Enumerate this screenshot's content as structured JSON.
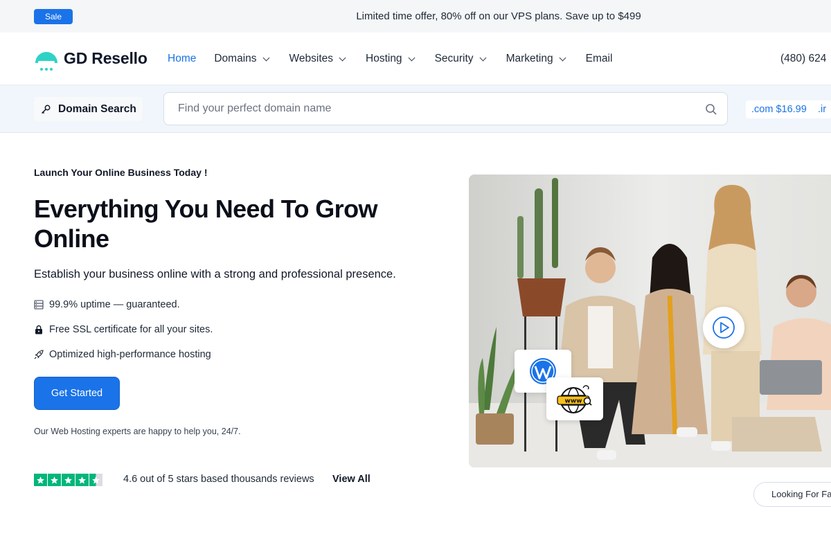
{
  "promo": {
    "badge": "Sale",
    "text": "Limited time offer, 80% off on our VPS plans. Save up to $499"
  },
  "header": {
    "brand": "GD Resello",
    "nav": [
      {
        "label": "Home",
        "active": true,
        "dropdown": false
      },
      {
        "label": "Domains",
        "active": false,
        "dropdown": true
      },
      {
        "label": "Websites",
        "active": false,
        "dropdown": true
      },
      {
        "label": "Hosting",
        "active": false,
        "dropdown": true
      },
      {
        "label": "Security",
        "active": false,
        "dropdown": true
      },
      {
        "label": "Marketing",
        "active": false,
        "dropdown": true
      },
      {
        "label": "Email",
        "active": false,
        "dropdown": false
      }
    ],
    "phone": "(480) 624"
  },
  "domain_search": {
    "label": "Domain Search",
    "placeholder": "Find your perfect domain name",
    "value": "",
    "tld_price": ".com $16.99",
    "tld_next": ".ir"
  },
  "hero": {
    "eyebrow": "Launch Your Online Business Today !",
    "headline": "Everything You Need To Grow Online",
    "subhead": "Establish your business online with a strong and professional presence.",
    "features": [
      {
        "icon": "server-icon",
        "text": "99.9% uptime — guaranteed."
      },
      {
        "icon": "lock-icon",
        "text": "Free SSL certificate for all your sites."
      },
      {
        "icon": "rocket-icon",
        "text": "Optimized high-performance hosting"
      }
    ],
    "cta": "Get Started",
    "help_text": "Our Web Hosting experts are happy to help you, 24/7.",
    "rating": {
      "stars": 4.6,
      "text": "4.6 out of 5 stars based thousands reviews",
      "view_all": "View All"
    },
    "looking_for": "Looking For Fa",
    "www_badge": "www"
  },
  "colors": {
    "accent": "#1a73e8",
    "logo_teal": "#2ed3c6",
    "trustpilot_green": "#00b67a",
    "promo_bg": "#f4f6f8",
    "search_bg": "#f0f6fb"
  }
}
